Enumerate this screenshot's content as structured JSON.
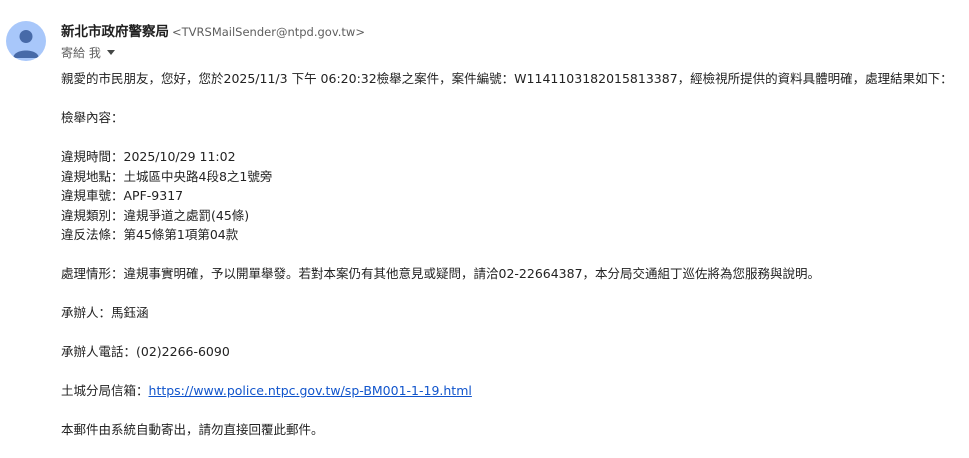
{
  "sender": {
    "name": "新北市政府警察局",
    "email": "<TVRSMailSender@ntpd.gov.tw>"
  },
  "recipient": {
    "label": "寄給 我"
  },
  "body": {
    "greeting": "親愛的市民朋友，您好，您於2025/11/3 下午 06:20:32檢舉之案件，案件編號：W1141103182015813387，經檢視所提供的資料具體明確，處理結果如下：",
    "section_title": "檢舉內容：",
    "details": [
      "違規時間：2025/10/29 11:02",
      "違規地點：土城區中央路4段8之1號旁",
      "違規車號：APF-9317",
      "違規類別：違規爭道之處罰(45條)",
      "違反法條：第45條第1項第04款"
    ],
    "handling": "處理情形：違規事實明確，予以開單舉發。若對本案仍有其他意見或疑問，請洽02-22664387，本分局交通組丁巡佐將為您服務與說明。",
    "officer": "承辦人：馬鈺涵",
    "officer_phone": "承辦人電話：(02)2266-6090",
    "mailbox_label": "土城分局信箱：",
    "mailbox_url": "https://www.police.ntpc.gov.tw/sp-BM001-1-19.html",
    "footer": "本郵件由系統自動寄出，請勿直接回覆此郵件。"
  }
}
